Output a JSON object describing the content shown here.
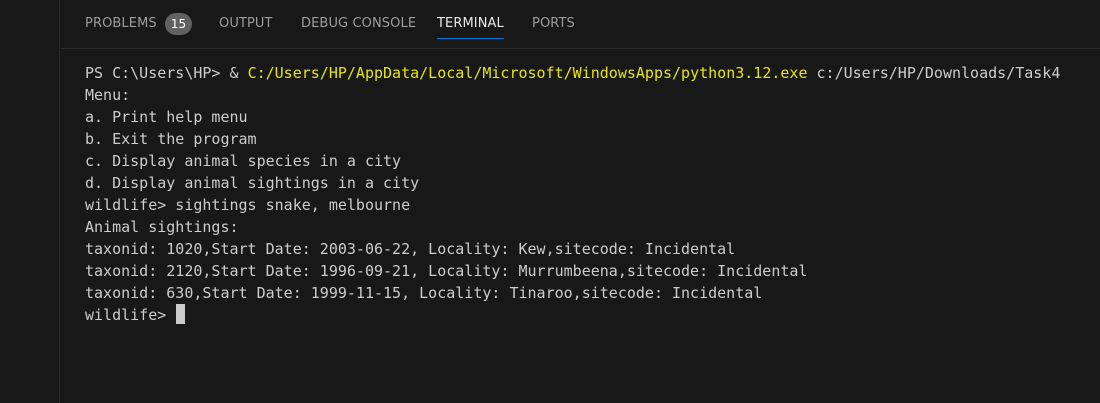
{
  "tabs": [
    {
      "label": "PROBLEMS",
      "badge": "15"
    },
    {
      "label": "OUTPUT"
    },
    {
      "label": "DEBUG CONSOLE"
    },
    {
      "label": "TERMINAL"
    },
    {
      "label": "PORTS"
    }
  ],
  "active_tab": "TERMINAL",
  "terminal": {
    "command": {
      "prompt": "PS C:\\Users\\HP> & ",
      "exe_path": "C:/Users/HP/AppData/Local/Microsoft/WindowsApps/python3.12.exe",
      "arg": " c:/Users/HP/Downloads/Task4"
    },
    "lines": [
      "Menu:",
      "a. Print help menu",
      "b. Exit the program",
      "c. Display animal species in a city",
      "d. Display animal sightings in a city",
      "wildlife> sightings snake, melbourne",
      "Animal sightings:",
      "taxonid: 1020,Start Date: 2003-06-22, Locality: Kew,sitecode: Incidental",
      "taxonid: 2120,Start Date: 1996-09-21, Locality: Murrumbeena,sitecode: Incidental",
      "taxonid: 630,Start Date: 1999-11-15, Locality: Tinaroo,sitecode: Incidental"
    ],
    "current_prompt": "wildlife> "
  },
  "colors": {
    "background": "#181818",
    "text": "#cccccc",
    "path_yellow": "#e5e510",
    "active_tab_underline": "#0078d4",
    "badge_bg": "#616161"
  }
}
